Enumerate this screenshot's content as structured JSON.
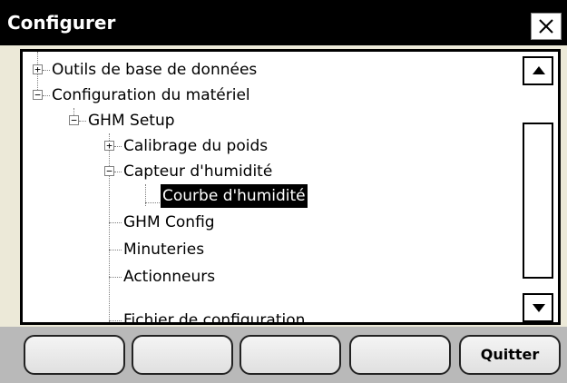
{
  "window": {
    "title": "Configurer"
  },
  "tree": {
    "nodes": [
      {
        "label": "Outils de base de données",
        "expander": "+"
      },
      {
        "label": "Configuration du matériel",
        "expander": "−"
      },
      {
        "label": "GHM Setup",
        "expander": "−"
      },
      {
        "label": "Calibrage du poids",
        "expander": "+"
      },
      {
        "label": "Capteur d'humidité",
        "expander": "−"
      },
      {
        "label": "Courbe d'humidité",
        "selected": true
      },
      {
        "label": "GHM Config"
      },
      {
        "label": "Minuteries"
      },
      {
        "label": "Actionneurs"
      },
      {
        "label": "Fichier de configuration"
      }
    ]
  },
  "buttons": {
    "b1": "",
    "b2": "",
    "b3": "",
    "b4": "",
    "quit": "Quitter"
  },
  "icons": {
    "close": "close-icon",
    "scroll_up": "triangle-up-icon",
    "scroll_down": "triangle-down-icon"
  }
}
